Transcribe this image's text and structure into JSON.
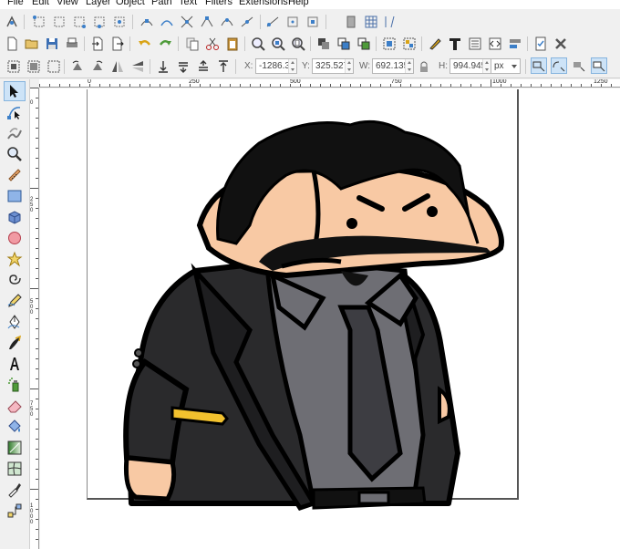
{
  "menu": [
    "File",
    "Edit",
    "View",
    "Layer",
    "Object",
    "Path",
    "Text",
    "Filters",
    "Extensions",
    "Help"
  ],
  "selectbar": {
    "x_label": "X:",
    "x_value": "-1286.3",
    "y_label": "Y:",
    "y_value": "325.527",
    "w_label": "W:",
    "w_value": "692.135",
    "h_label": "H:",
    "h_value": "994.945",
    "unit": "px"
  },
  "ruler": {
    "h_labels": [
      "0",
      "250",
      "500",
      "750",
      "1000",
      "1250"
    ],
    "v_labels": [
      "0",
      "250",
      "500",
      "750",
      "1000"
    ]
  },
  "colors": {
    "accent": "#3c7fc8",
    "active_tool": "#cde3f7",
    "suit": "#2a2a2c",
    "shirt": "#6e6e74",
    "skin": "#f8c9a4"
  },
  "tools": [
    "selector-icon",
    "node-icon",
    "tweak-icon",
    "zoom-icon",
    "measure-icon",
    "rect-icon",
    "box3d-icon",
    "ellipse-icon",
    "star-icon",
    "spiral-icon",
    "pencil-icon",
    "pen-icon",
    "calligraphy-icon",
    "text-icon",
    "spray-icon",
    "eraser-icon",
    "bucket-icon",
    "gradient-icon",
    "mesh-icon",
    "dropper-icon",
    "connector-icon"
  ]
}
